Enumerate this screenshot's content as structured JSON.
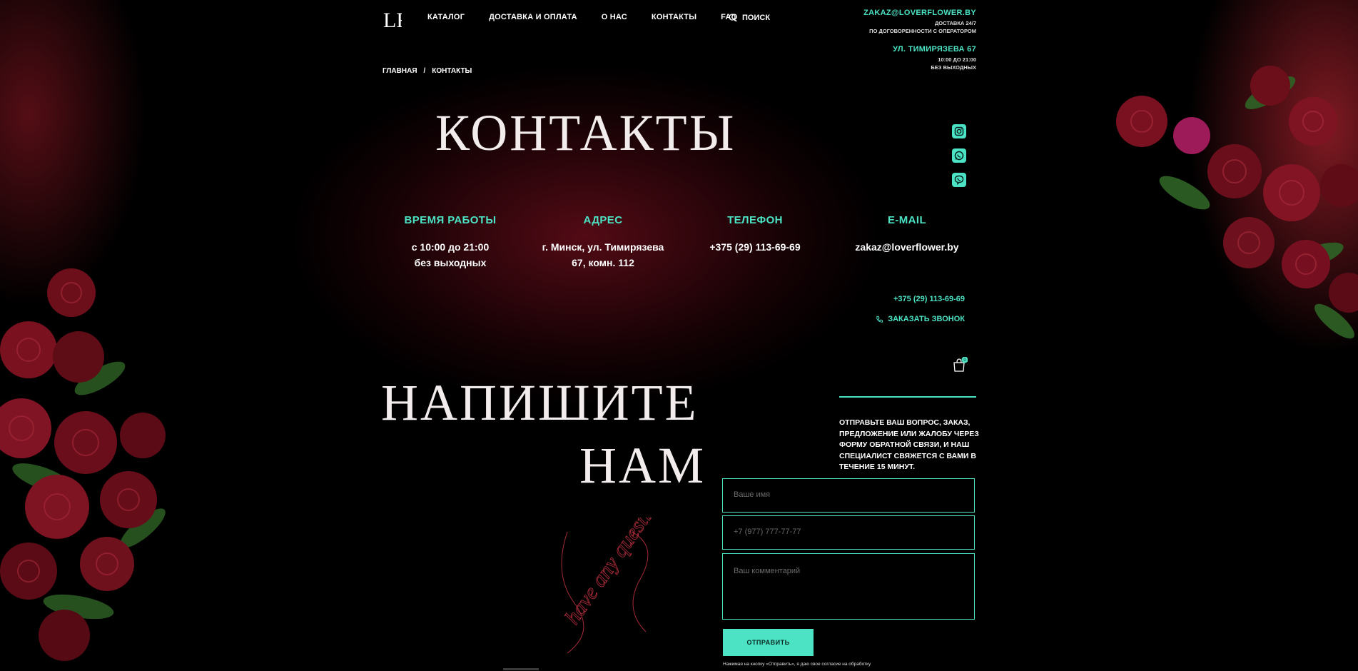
{
  "header": {
    "logo_text": "LF",
    "nav": [
      "КАТАЛОГ",
      "ДОСТАВКА И ОПЛАТА",
      "О НАС",
      "КОНТАКТЫ",
      "FAQ"
    ],
    "search_label": "ПОИСК"
  },
  "contact_top": {
    "email": "ZAKAZ@LOVERFLOWER.BY",
    "delivery_line1": "ДОСТАВКА 24/7",
    "delivery_line2": "ПО ДОГОВОРЕННОСТИ С ОПЕРАТОРОМ",
    "address": "УЛ. ТИМИРЯЗЕВА 67",
    "hours_line1": "10:00 ДО 21:00",
    "hours_line2": "БЕЗ ВЫХОДНЫХ"
  },
  "breadcrumb": {
    "home": "ГЛАВНАЯ",
    "separator": "/",
    "current": "КОНТАКТЫ"
  },
  "page_title": "КОНТАКТЫ",
  "social": [
    "instagram-icon",
    "whatsapp-icon",
    "viber-icon"
  ],
  "info": [
    {
      "heading": "ВРЕМЯ РАБОТЫ",
      "line1": "с 10:00 до 21:00",
      "line2": "без выходных"
    },
    {
      "heading": "АДРЕС",
      "line1": "г. Минск, ул. Тимирязева",
      "line2": "67, комн. 112"
    },
    {
      "heading": "ТЕЛЕФОН",
      "line1": "+375 (29) 113-69-69",
      "line2": ""
    },
    {
      "heading": "E-MAIL",
      "line1": "zakaz@loverflower.by",
      "line2": ""
    }
  ],
  "callback": {
    "phone": "+375 (29) 113-69-69",
    "button": "ЗАКАЗАТЬ ЗВОНОК"
  },
  "cart": {
    "count": "0"
  },
  "write_title": {
    "line1": "НАПИШИТЕ",
    "line2": "НАМ"
  },
  "script_text": "have any questions",
  "form": {
    "description": "ОТПРАВЬТЕ ВАШ ВОПРОС, ЗАКАЗ, ПРЕДЛОЖЕНИЕ ИЛИ ЖАЛОБУ ЧЕРЕЗ ФОРМУ ОБРАТНОЙ СВЯЗИ, И НАШ СПЕЦИАЛИСТ СВЯЖЕТСЯ С ВАМИ В ТЕЧЕНИЕ 15 МИНУТ.",
    "name_placeholder": "Ваше имя",
    "phone_placeholder": "+7 (977) 777-77-77",
    "comment_placeholder": "Ваш комментарий",
    "submit": "ОТПРАВИТЬ",
    "consent": "Нажимая на кнопку «Отправить», я даю свое согласие на обработку"
  },
  "colors": {
    "accent": "#4be3c4",
    "background": "#000000"
  }
}
